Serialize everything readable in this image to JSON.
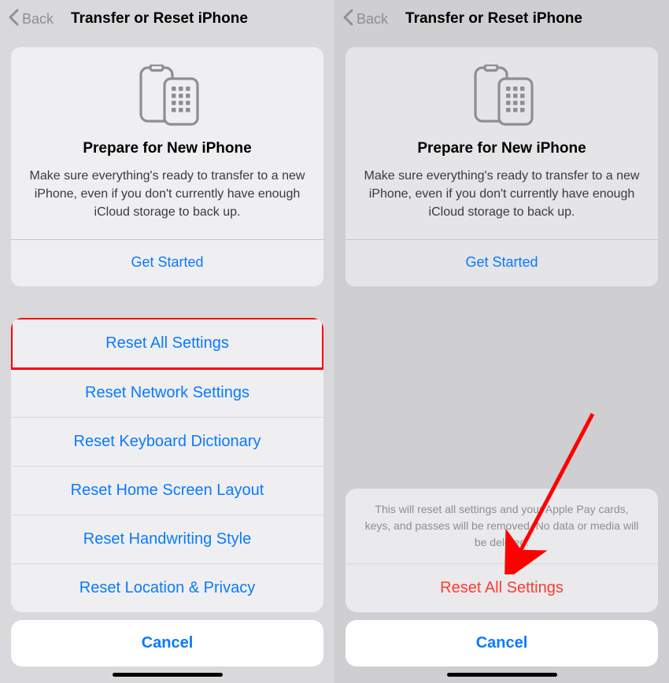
{
  "nav": {
    "back": "Back",
    "title": "Transfer or Reset iPhone"
  },
  "hero": {
    "title": "Prepare for New iPhone",
    "desc": "Make sure everything's ready to transfer to a new iPhone, even if you don't currently have enough iCloud storage to back up.",
    "get_started": "Get Started"
  },
  "sheet": {
    "items": [
      "Reset All Settings",
      "Reset Network Settings",
      "Reset Keyboard Dictionary",
      "Reset Home Screen Layout",
      "Reset Handwriting Style",
      "Reset Location & Privacy"
    ],
    "cancel": "Cancel"
  },
  "confirm": {
    "text": "This will reset all settings and your Apple Pay cards, keys, and passes will be removed. No data or media will be deleted.",
    "action": "Reset All Settings",
    "cancel": "Cancel"
  }
}
